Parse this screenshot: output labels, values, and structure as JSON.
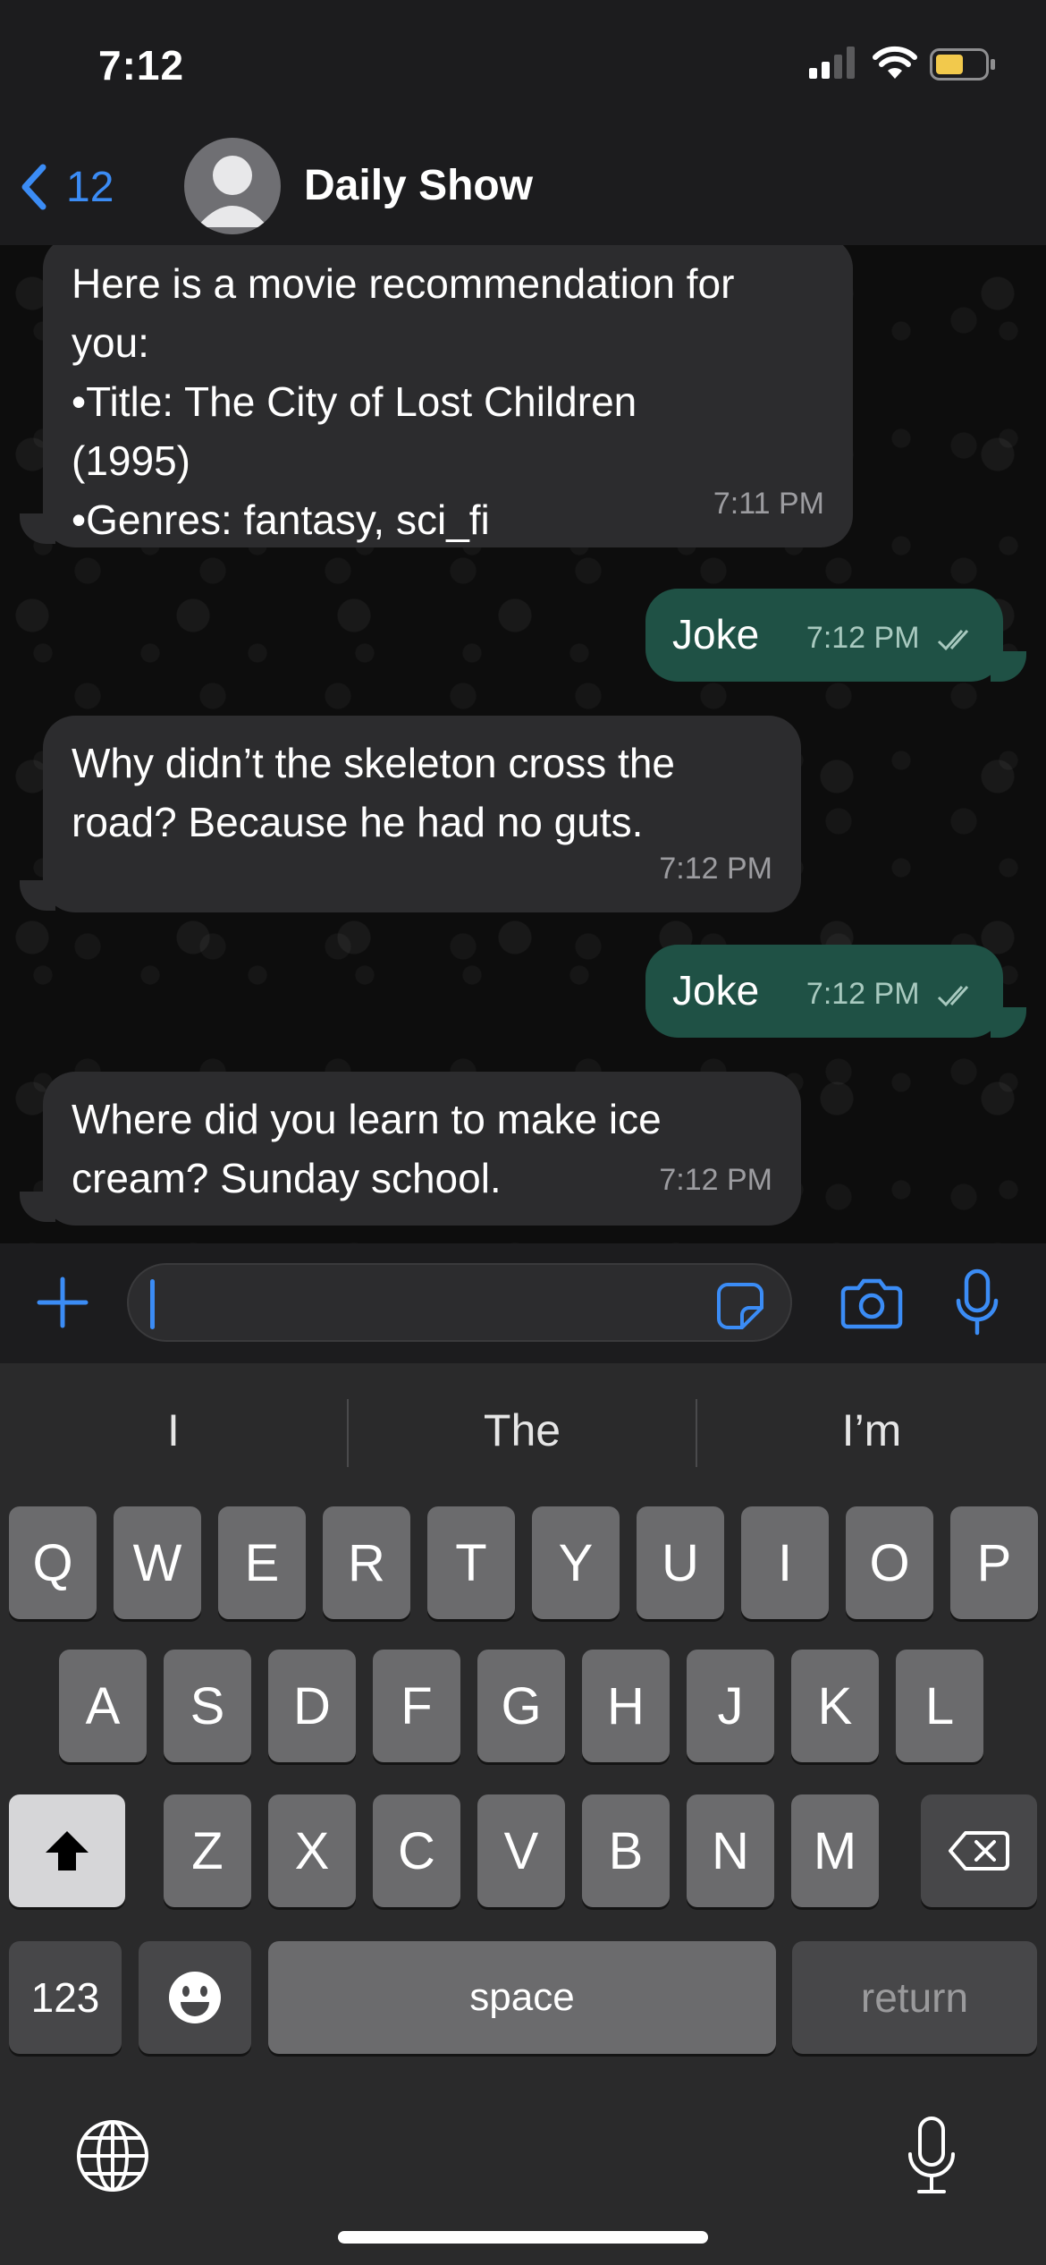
{
  "status_bar": {
    "time": "7:12"
  },
  "header": {
    "back_count": "12",
    "title": "Daily Show"
  },
  "messages": [
    {
      "side": "in",
      "text": "Here is a movie recommendation for\nyou:\n•Title: The City of Lost Children\n(1995)\n•Genres: fantasy, sci_fi",
      "time": "7:11 PM"
    },
    {
      "side": "out",
      "text": "Joke",
      "time": "7:12 PM",
      "status": "read"
    },
    {
      "side": "in",
      "text": "Why didn’t the skeleton cross the\nroad? Because he had no guts.",
      "time": "7:12 PM"
    },
    {
      "side": "out",
      "text": "Joke",
      "time": "7:12 PM",
      "status": "read"
    },
    {
      "side": "in",
      "text": "Where did you learn to make ice\ncream? Sunday school.",
      "time": "7:12 PM"
    }
  ],
  "composer": {
    "value": ""
  },
  "keyboard": {
    "suggestions": [
      "I",
      "The",
      "I’m"
    ],
    "row1": [
      "Q",
      "W",
      "E",
      "R",
      "T",
      "Y",
      "U",
      "I",
      "O",
      "P"
    ],
    "row2": [
      "A",
      "S",
      "D",
      "F",
      "G",
      "H",
      "J",
      "K",
      "L"
    ],
    "row3": [
      "Z",
      "X",
      "C",
      "V",
      "B",
      "N",
      "M"
    ],
    "numbers_key": "123",
    "space_key": "space",
    "return_key": "return"
  },
  "colors": {
    "accent": "#3b8cf5",
    "outgoing_bubble": "#1f5145",
    "incoming_bubble": "#2c2c2e"
  }
}
